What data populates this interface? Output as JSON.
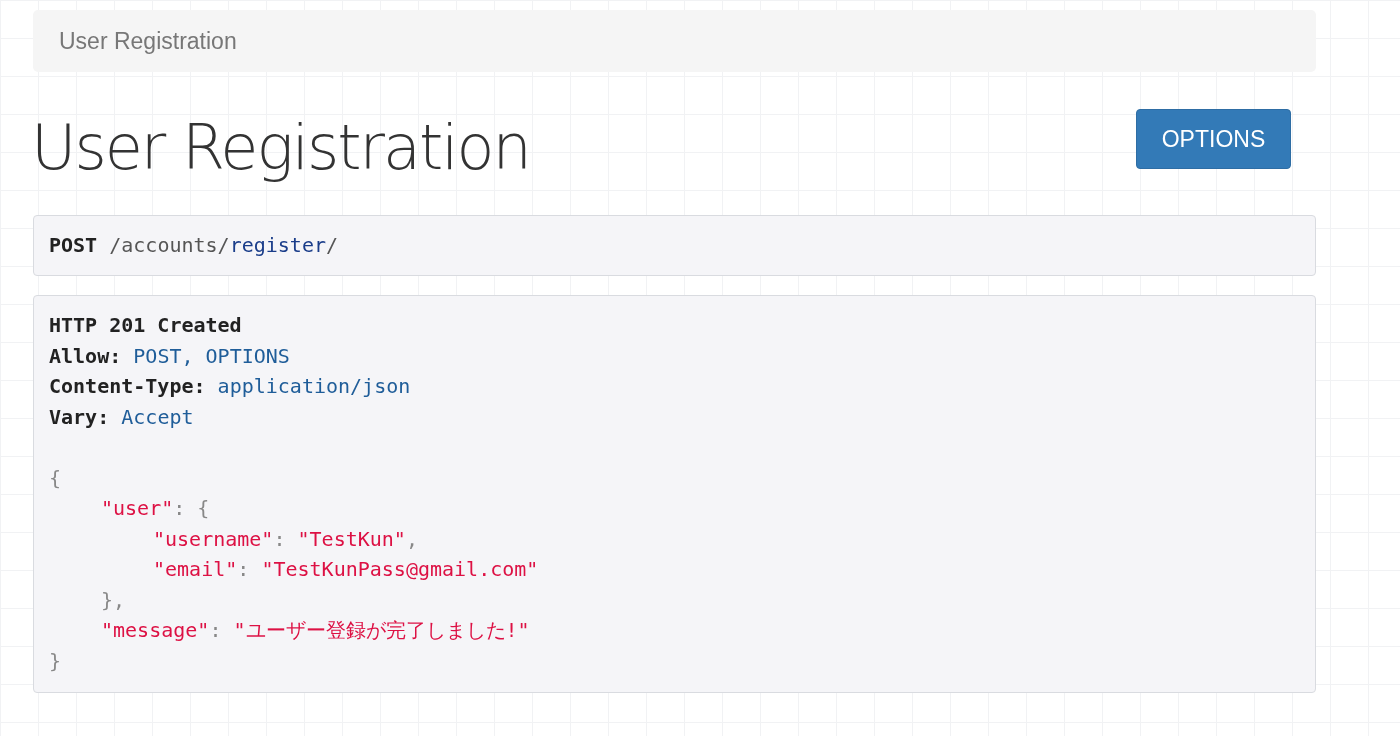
{
  "breadcrumb": {
    "label": "User Registration"
  },
  "title": "User Registration",
  "options_button": {
    "label": "OPTIONS"
  },
  "request": {
    "method": "POST",
    "path": [
      {
        "kind": "plain",
        "text": "/accounts/"
      },
      {
        "kind": "link",
        "text": "register"
      },
      {
        "kind": "plain",
        "text": "/"
      }
    ]
  },
  "response": {
    "status": "HTTP 201 Created",
    "headers": [
      {
        "name": "Allow:",
        "value": "POST, OPTIONS"
      },
      {
        "name": "Content-Type:",
        "value": "application/json"
      },
      {
        "name": "Vary:",
        "value": "Accept"
      }
    ],
    "body": {
      "open": [
        {
          "kind": "punct",
          "text": "{"
        }
      ],
      "children": [
        {
          "open": [
            {
              "kind": "string",
              "text": "\"user\""
            },
            {
              "kind": "punct",
              "text": ": {"
            }
          ],
          "children": [
            {
              "open": [
                {
                  "kind": "string",
                  "text": "\"username\""
                },
                {
                  "kind": "punct",
                  "text": ": "
                },
                {
                  "kind": "string",
                  "text": "\"TestKun\""
                },
                {
                  "kind": "punct",
                  "text": ","
                }
              ]
            },
            {
              "open": [
                {
                  "kind": "string",
                  "text": "\"email\""
                },
                {
                  "kind": "punct",
                  "text": ": "
                },
                {
                  "kind": "string",
                  "text": "\"TestKunPass@gmail.com\""
                }
              ]
            }
          ],
          "close": [
            {
              "kind": "punct",
              "text": "},"
            }
          ]
        },
        {
          "open": [
            {
              "kind": "string",
              "text": "\"message\""
            },
            {
              "kind": "punct",
              "text": ": "
            },
            {
              "kind": "string",
              "text": "\"ユーザー登録が完了しました!\""
            }
          ]
        }
      ],
      "close": [
        {
          "kind": "punct",
          "text": "}"
        }
      ]
    }
  }
}
